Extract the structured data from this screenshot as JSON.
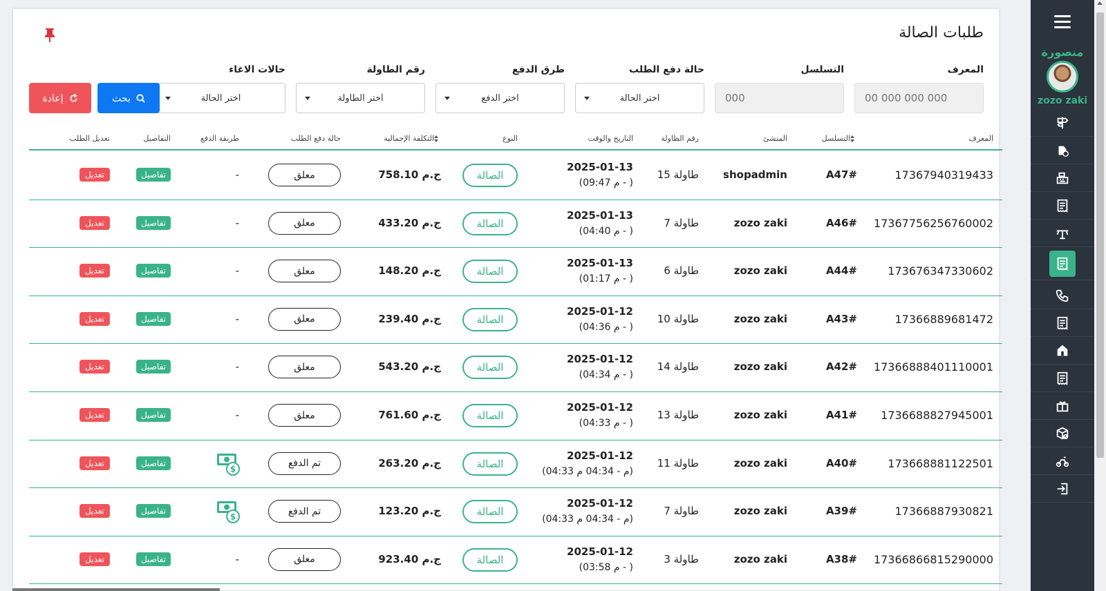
{
  "sidebar": {
    "shop_name": "منصورة",
    "user_name": "zozo zaki",
    "items": [
      {
        "icon": "signpost-icon"
      },
      {
        "icon": "hand-money-icon"
      },
      {
        "icon": "cash-register-icon"
      },
      {
        "icon": "receipt-icon"
      },
      {
        "icon": "dining-table-icon"
      },
      {
        "icon": "receipt-active-icon",
        "active": true
      },
      {
        "icon": "phone-icon"
      },
      {
        "icon": "receipt-icon-2"
      },
      {
        "icon": "store-icon"
      },
      {
        "icon": "receipt-icon-3"
      },
      {
        "icon": "gift-icon"
      },
      {
        "icon": "package-search-icon"
      },
      {
        "icon": "delivery-bike-icon"
      },
      {
        "icon": "logout-icon"
      }
    ]
  },
  "header": {
    "title": "طلبات الصالة"
  },
  "filters": {
    "id_label": "المعرف",
    "id_placeholder": "00 000 000 000",
    "serial_label": "التسلسل",
    "serial_placeholder": "000",
    "payment_status_label": "حالة دفع الطلب",
    "payment_status_value": "اختر الحالة",
    "payment_method_label": "طرق الدفع",
    "payment_method_value": "اختر الدفع",
    "table_label": "رقم الطاولة",
    "table_value": "اختر الطاولة",
    "cancel_label": "حالات الاغاء",
    "cancel_value": "اختر الحالة",
    "search_label": "بحث",
    "reset_label": "إعادة"
  },
  "table": {
    "headers": {
      "id": "المعرف",
      "serial": "التسلسل",
      "creator": "المنشئ",
      "table_no": "رقم الطاولة",
      "datetime": "التاريخ والوقت",
      "type": "النوع",
      "total": "التكلفة الإجمالية",
      "payment_status": "حالة دفع الطلب",
      "payment_method": "طريقة الدفع",
      "details": "التفاصيل",
      "edit": "تعديل الطلب"
    },
    "rows": [
      {
        "id": "17367940319433",
        "serial": "A47#",
        "creator": "shopadmin",
        "table": "طاولة 15",
        "date": "2025-01-13",
        "time": "(09:47 م - )",
        "type": "الصالة",
        "cost": "758.10 ج.م",
        "status": "معلق",
        "pay": "-",
        "paid": false,
        "details": "تفاصيل",
        "edit": "تعديل"
      },
      {
        "id": "17367756256760002",
        "serial": "A46#",
        "creator": "zozo zaki",
        "table": "طاولة 7",
        "date": "2025-01-13",
        "time": "(04:40 م - )",
        "type": "الصالة",
        "cost": "433.20 ج.م",
        "status": "معلق",
        "pay": "-",
        "paid": false,
        "details": "تفاصيل",
        "edit": "تعديل"
      },
      {
        "id": "173676347330602",
        "serial": "A44#",
        "creator": "zozo zaki",
        "table": "طاولة 6",
        "date": "2025-01-13",
        "time": "(01:17 م - )",
        "type": "الصالة",
        "cost": "148.20 ج.م",
        "status": "معلق",
        "pay": "-",
        "paid": false,
        "details": "تفاصيل",
        "edit": "تعديل"
      },
      {
        "id": "17366889681472",
        "serial": "A43#",
        "creator": "zozo zaki",
        "table": "طاولة 10",
        "date": "2025-01-12",
        "time": "(04:36 م - )",
        "type": "الصالة",
        "cost": "239.40 ج.م",
        "status": "معلق",
        "pay": "-",
        "paid": false,
        "details": "تفاصيل",
        "edit": "تعديل"
      },
      {
        "id": "17366888401110001",
        "serial": "A42#",
        "creator": "zozo zaki",
        "table": "طاولة 14",
        "date": "2025-01-12",
        "time": "(04:34 م - )",
        "type": "الصالة",
        "cost": "543.20 ج.م",
        "status": "معلق",
        "pay": "-",
        "paid": false,
        "details": "تفاصيل",
        "edit": "تعديل"
      },
      {
        "id": "1736688827945001",
        "serial": "A41#",
        "creator": "zozo zaki",
        "table": "طاولة 13",
        "date": "2025-01-12",
        "time": "(04:33 م - )",
        "type": "الصالة",
        "cost": "761.60 ج.م",
        "status": "معلق",
        "pay": "-",
        "paid": false,
        "details": "تفاصيل",
        "edit": "تعديل"
      },
      {
        "id": "173668881122501",
        "serial": "A40#",
        "creator": "zozo zaki",
        "table": "طاولة 11",
        "date": "2025-01-12",
        "time": "(04:33 م - 04:34 م)",
        "type": "الصالة",
        "cost": "263.20 ج.م",
        "status": "تم الدفع",
        "pay": "",
        "paid": true,
        "details": "تفاصيل",
        "edit": "تعديل"
      },
      {
        "id": "17366887930821",
        "serial": "A39#",
        "creator": "zozo zaki",
        "table": "طاولة 7",
        "date": "2025-01-12",
        "time": "(04:33 م - 04:34 م)",
        "type": "الصالة",
        "cost": "123.20 ج.م",
        "status": "تم الدفع",
        "pay": "",
        "paid": true,
        "details": "تفاصيل",
        "edit": "تعديل"
      },
      {
        "id": "17366866815290000",
        "serial": "A38#",
        "creator": "zozo zaki",
        "table": "طاولة 3",
        "date": "2025-01-12",
        "time": "(03:58 م - )",
        "type": "الصالة",
        "cost": "923.40 ج.م",
        "status": "معلق",
        "pay": "-",
        "paid": false,
        "details": "تفاصيل",
        "edit": "تعديل"
      }
    ]
  },
  "colors": {
    "accent": "#3bb38a",
    "danger": "#f0545b",
    "primary": "#0d78f2",
    "sidebar": "#2b333d"
  }
}
